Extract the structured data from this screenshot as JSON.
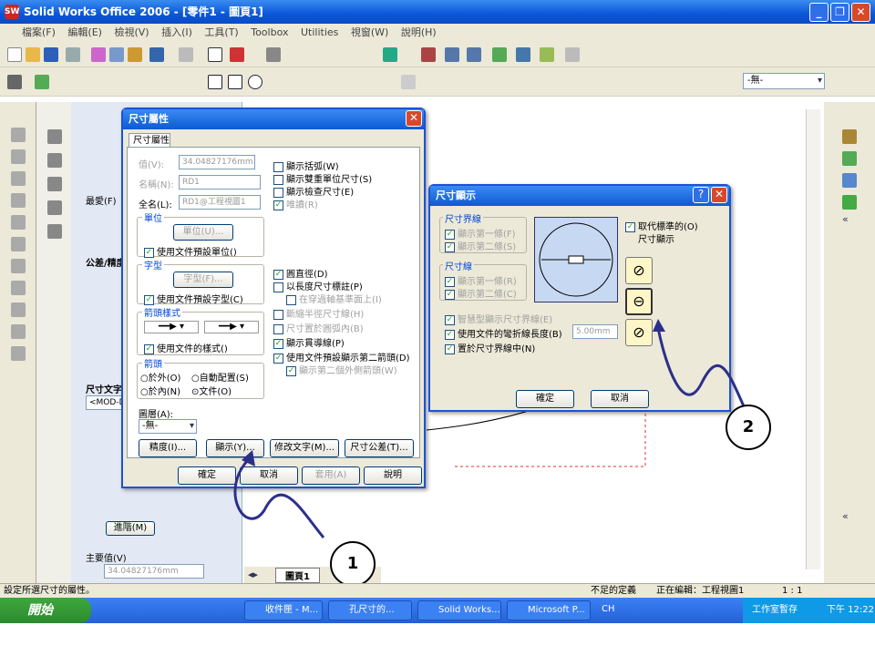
{
  "window": {
    "title": "Solid Works Office 2006 - [零件1 - 圖頁1]"
  },
  "menu": [
    "檔案(F)",
    "編輯(E)",
    "檢視(V)",
    "插入(I)",
    "工具(T)",
    "Toolbox",
    "Utilities",
    "視窗(W)",
    "說明(H)"
  ],
  "layer_select": "-無-",
  "pm": {
    "fav_label": "最愛(F)",
    "tol_label": "公差/精度",
    "text_label": "尺寸文字",
    "text_value": "<MOD-DIA",
    "more_btn": "進階(M)",
    "primary_label": "主要值(V)",
    "primary_value": "34.04827176mm"
  },
  "dim_dialog": {
    "title": "尺寸屬性",
    "tab": "尺寸屬性",
    "value_label": "值(V):",
    "value": "34.04827176mm",
    "name_label": "名稱(N):",
    "name": "RD1",
    "full_label": "全名(L):",
    "full": "RD1@工程視圖1",
    "unit_group": "單位",
    "unit_btn": "單位(U)...",
    "unit_cb": "使用文件預設單位()",
    "font_group": "字型",
    "font_btn": "字型(F)...",
    "font_cb": "使用文件預設字型(C)",
    "arrow_group": "箭頭樣式",
    "arrow_cb": "使用文件的樣式()",
    "arrows_group": "箭頭",
    "arr_out": "於外(O)",
    "arr_auto": "自動配置(S)",
    "arr_in": "於內(N)",
    "arr_doc": "文件(O)",
    "layer_label": "圖層(A):",
    "layer": "-無-",
    "checks": [
      "顯示括弧(W)",
      "顯示雙重單位尺寸(S)",
      "顯示檢查尺寸(E)",
      "唯讀(R)",
      "圓直徑(D)",
      "以長度尺寸標註(P)",
      "在穿過軸基準面上(I)",
      "斷縮半徑尺寸線(H)",
      "尺寸置於圓弧內(B)",
      "顯示貫導線(P)",
      "使用文件預設顯示第二箭頭(D)",
      "顯示第二個外側箭頭(W)"
    ],
    "bottom_btns": [
      "精度(I)...",
      "顯示(Y)...",
      "修改文字(M)...",
      "尺寸公差(T)..."
    ],
    "ok": "確定",
    "cancel": "取消",
    "apply": "套用(A)",
    "help": "說明"
  },
  "display_dialog": {
    "title": "尺寸顯示",
    "ext_group": "尺寸界線",
    "ext1": "顯示第一條(F)",
    "ext2": "顯示第二條(S)",
    "dim_group": "尺寸線",
    "dim1": "顯示第一條(R)",
    "dim2": "顯示第二條(C)",
    "override": "取代標準的(O)",
    "override2": "尺寸顯示",
    "smart": "智慧型顯示尺寸界線(E)",
    "doclen": "使用文件的彎折線長度(B)",
    "doclen_value": "5.00mm",
    "center": "置於尺寸界線中(N)",
    "ok": "確定",
    "cancel": "取消"
  },
  "sheet_tab": "圖頁1",
  "status": {
    "left": "設定所選尺寸的屬性。",
    "state": "不足的定義",
    "editing": "正在編輯：工程視圖1",
    "scale": "1 : 1"
  },
  "taskbar": {
    "start": "開始",
    "tasks": [
      "收件匣 - M...",
      "孔尺寸的...",
      "Solid Works...",
      "Microsoft P..."
    ],
    "lang": "CH",
    "tray": "工作室暫存",
    "time": "下午 12:22"
  },
  "callouts": [
    "1",
    "2"
  ]
}
